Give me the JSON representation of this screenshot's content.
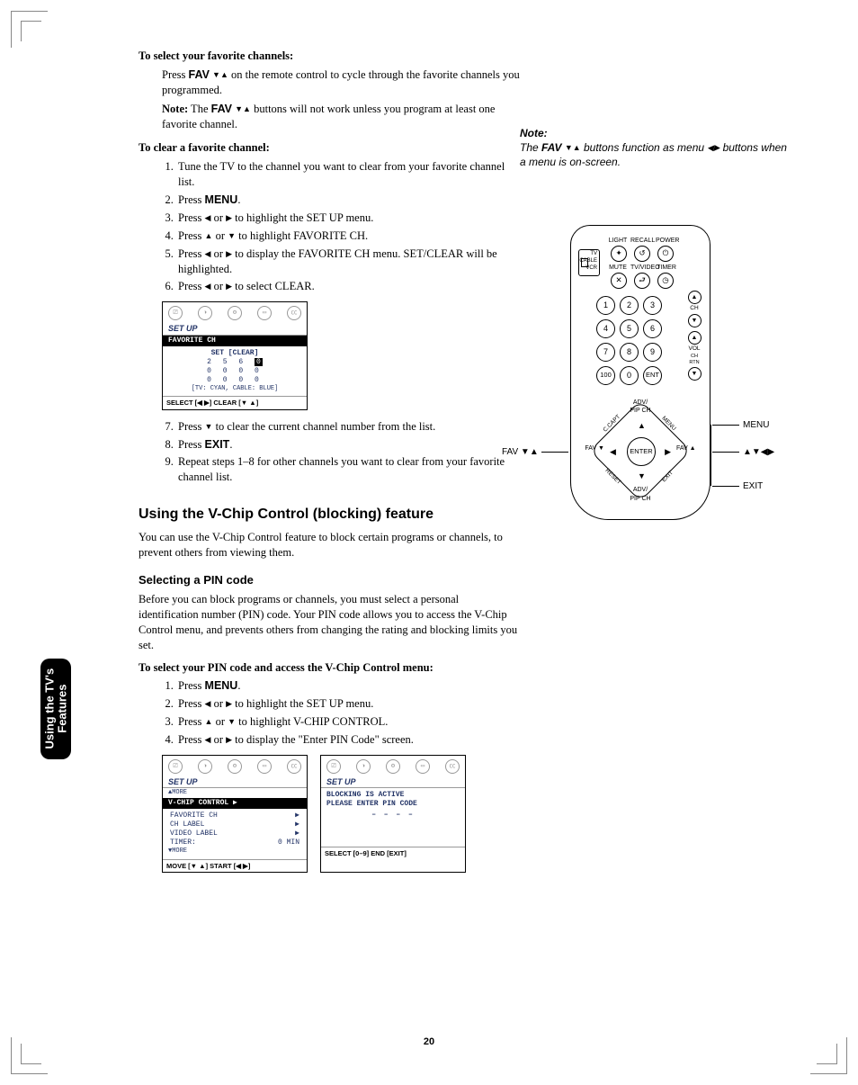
{
  "page_number": "20",
  "side_tab": {
    "line1": "Using the TV's",
    "line2": "Features"
  },
  "main": {
    "sec1": {
      "heading": "To select your favorite channels:",
      "para1a": "Press ",
      "fav_label": "FAV",
      "para1b": " on the remote control to cycle through the favorite channels you programmed.",
      "note_label": "Note:",
      "note_body_a": " The ",
      "note_body_b": " buttons will not work unless you program at least one favorite channel."
    },
    "sec2": {
      "heading": "To clear a favorite channel:",
      "steps": {
        "1": "Tune the TV to the channel you want to clear from your favorite channel list.",
        "2a": "Press ",
        "2b": "MENU",
        "2c": ".",
        "3a": "Press ",
        "3b": " or ",
        "3c": " to highlight the SET UP menu.",
        "4a": "Press ",
        "4b": " or ",
        "4c": " to highlight FAVORITE CH.",
        "5a": "Press ",
        "5b": " or ",
        "5c": " to display the FAVORITE CH menu. SET/CLEAR will be highlighted.",
        "6a": "Press ",
        "6b": " or ",
        "6c": " to select CLEAR.",
        "7a": "Press ",
        "7b": " to clear the current channel number from the list.",
        "8a": "Press ",
        "8b": "EXIT",
        "8c": ".",
        "9": "Repeat steps 1–8 for other channels you want to clear from your favorite channel list."
      }
    },
    "osd1": {
      "title": "SET UP",
      "row_sel": "FAVORITE CH",
      "setclear": "SET  [CLEAR]",
      "grid": {
        "r1": [
          "2",
          "5",
          "6",
          "0"
        ],
        "r2": [
          "0",
          "0",
          "0",
          "0"
        ],
        "r3": [
          "0",
          "0",
          "0",
          "0"
        ]
      },
      "legend": "[TV: CYAN,  CABLE: BLUE]",
      "footer": "SELECT [◀ ▶]   CLEAR [▼ ▲]"
    },
    "feature_title": "Using the V-Chip Control (blocking) feature",
    "feature_intro": "You can use the V-Chip Control feature to block certain programs or channels, to prevent others from viewing them.",
    "pin_sub": "Selecting a PIN code",
    "pin_intro": "Before you can block programs or channels, you must select a personal identification number (PIN) code. Your PIN code allows you to access the V-Chip Control menu, and prevents others from changing the rating and blocking limits you set.",
    "pin_steps_head": "To select your PIN code and access the V-Chip Control menu:",
    "pin_steps": {
      "1a": "Press ",
      "1b": "MENU",
      "1c": ".",
      "2a": "Press ",
      "2b": " or ",
      "2c": " to highlight the SET UP menu.",
      "3a": "Press ",
      "3b": " or ",
      "3c": " to highlight V-CHIP CONTROL.",
      "4a": "Press ",
      "4b": " or ",
      "4c": " to display the \"Enter PIN Code\" screen."
    },
    "osd2": {
      "title": "SET UP",
      "more_up": "▲MORE",
      "row_sel": "V-CHIP CONTROL     ▶",
      "rows": {
        "r1": "FAVORITE CH",
        "r2": "CH LABEL",
        "r3": "VIDEO LABEL",
        "r4l": "TIMER:",
        "r4r": "0 MIN"
      },
      "more_dn": "▼MORE",
      "footer": "MOVE [▼ ▲]   START [◀ ▶]"
    },
    "osd3": {
      "title": "SET UP",
      "line1": "BLOCKING IS ACTIVE",
      "line2": "PLEASE ENTER PIN CODE",
      "dashes": "– – – –",
      "footer": "SELECT [0–9]   END [EXIT]"
    }
  },
  "right_note": {
    "head": "Note:",
    "body_a": "The ",
    "body_b": " buttons function as menu ",
    "body_c": " buttons when a menu is on-screen.",
    "fav": "FAV"
  },
  "remote": {
    "switch": {
      "l1": "TV",
      "l2": "CABLE",
      "l3": "VCR"
    },
    "top_row_labels": {
      "l": "LIGHT",
      "m": "RECALL",
      "r": "POWER"
    },
    "row2_labels": {
      "l": "MUTE",
      "m": "TV/VIDEO",
      "r": "TIMER"
    },
    "numbers": [
      "1",
      "2",
      "3",
      "4",
      "5",
      "6",
      "7",
      "8",
      "9",
      "100",
      "0",
      "ENT"
    ],
    "right_col": {
      "ch": "CH",
      "chrtn": "CH RTN",
      "vol": "VOL"
    },
    "dpad": {
      "enter": "ENTER",
      "corners": {
        "tl": "C.CAPT",
        "tr": "MENU",
        "bl": "RESET",
        "br": "EXIT"
      },
      "adv_top": "ADV/\nPIP CH",
      "adv_bot": "ADV/\nPIP CH",
      "fav_l": "FAV ▼",
      "fav_r": "FAV ▲"
    },
    "ext_labels": {
      "menu": "MENU",
      "arrows": "▲▼◀▶",
      "exit": "EXIT",
      "fav": "FAV ▼▲"
    }
  }
}
